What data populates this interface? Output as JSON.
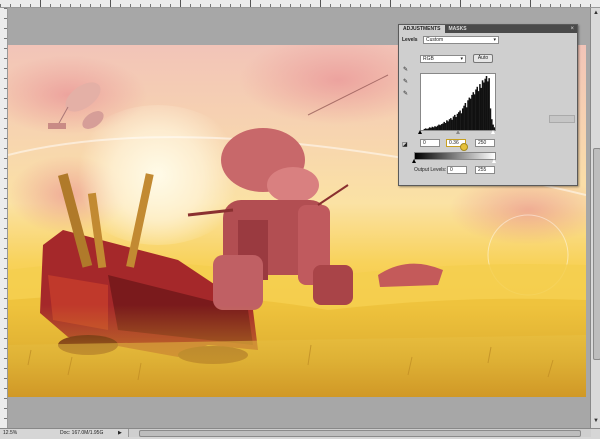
{
  "rulers": {
    "top_major_ticks": 8
  },
  "panel": {
    "tabs": [
      {
        "label": "ADJUSTMENTS",
        "active": true
      },
      {
        "label": "MASKS",
        "active": false
      }
    ],
    "close_glyph": "×",
    "section_title": "Levels",
    "preset_value": "Custom",
    "channel_value": "RGB",
    "auto_label": "Auto",
    "input_levels": {
      "black": "0",
      "gamma": "0.36",
      "white": "250"
    },
    "output_label": "Output Levels:",
    "output_levels": {
      "black": "0",
      "white": "255"
    }
  },
  "status": {
    "zoom": "12.5%",
    "doc": "Doc: 167.0M/1.95G"
  },
  "icons": [
    "eyedropper-black-icon",
    "eyedropper-gray-icon",
    "eyedropper-white-icon",
    "clip-icon",
    "panel-menu-icon"
  ],
  "histogram": [
    0.0,
    0.0,
    0.02,
    0.03,
    0.02,
    0.03,
    0.05,
    0.04,
    0.06,
    0.05,
    0.07,
    0.06,
    0.08,
    0.1,
    0.09,
    0.11,
    0.12,
    0.15,
    0.13,
    0.18,
    0.16,
    0.2,
    0.22,
    0.19,
    0.25,
    0.28,
    0.24,
    0.3,
    0.33,
    0.36,
    0.31,
    0.4,
    0.45,
    0.5,
    0.42,
    0.55,
    0.6,
    0.58,
    0.65,
    0.7,
    0.66,
    0.75,
    0.8,
    0.72,
    0.85,
    0.78,
    0.92,
    0.88,
    0.95,
    1.0,
    0.9,
    0.96,
    0.4,
    0.2,
    0.1,
    0.05
  ],
  "colors": {
    "panel_bg": "#cfcfcf",
    "tab_bar": "#4a4a4a",
    "pasteboard": "#a7a7a7"
  }
}
